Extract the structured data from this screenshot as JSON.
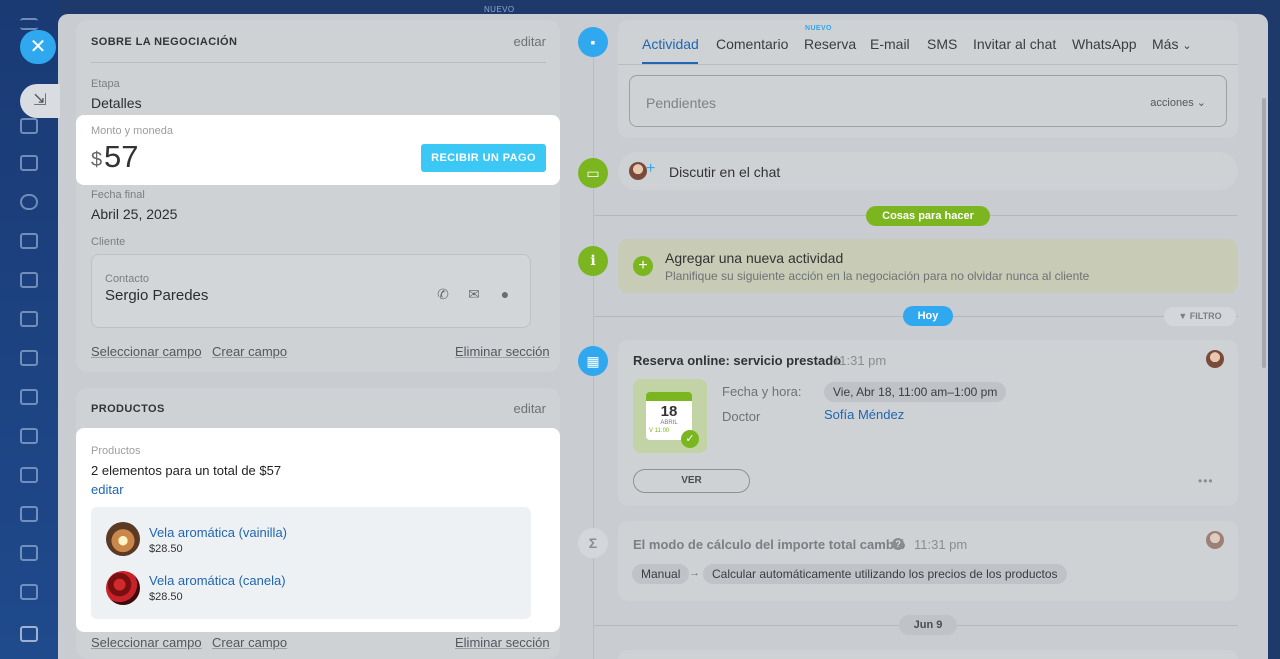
{
  "panel_top_nuevo": "NUEVO",
  "deal": {
    "title": "SOBRE LA NEGOCIACIÓN",
    "edit": "editar",
    "stage_label": "Etapa",
    "stage_value": "Detalles",
    "amount_label": "Monto y moneda",
    "amount_currency": "$",
    "amount_value": "57",
    "pay_button": "RECIBIR UN PAGO",
    "end_label": "Fecha final",
    "end_value": "Abril 25, 2025",
    "client_label": "Cliente",
    "contact_label": "Contacto",
    "contact_name": "Sergio Paredes",
    "select_field": "Seleccionar campo",
    "create_field": "Crear campo",
    "delete_section": "Eliminar sección"
  },
  "products": {
    "title": "PRODUCTOS",
    "edit": "editar",
    "label": "Productos",
    "summary": "2 elementos para un total de $57",
    "edit_link": "editar",
    "items": [
      {
        "name": "Vela aromática (vainilla)",
        "price": "$28.50"
      },
      {
        "name": "Vela aromática (canela)",
        "price": "$28.50"
      }
    ],
    "select_field": "Seleccionar campo",
    "create_field": "Crear campo",
    "delete_section": "Eliminar sección"
  },
  "tabs": {
    "items": [
      "Actividad",
      "Comentario",
      "Reserva",
      "E-mail",
      "SMS",
      "Invitar al chat",
      "WhatsApp",
      "Más"
    ],
    "reserva_badge": "NUEVO",
    "pending_placeholder": "Pendientes",
    "actions": "acciones"
  },
  "chat": {
    "label": "Discutir en el chat"
  },
  "todo_pill": "Cosas para hacer",
  "add_activity": {
    "title": "Agregar una nueva actividad",
    "subtitle": "Planifique su siguiente acción en la negociación para no olvidar nunca al cliente"
  },
  "today_pill": "Hoy",
  "filter": "FILTRO",
  "booking": {
    "title": "Reserva online: servicio prestado",
    "time": "11:31 pm",
    "cal_day": "18",
    "cal_month": "ABRIL",
    "cal_time": "V 11:00",
    "date_label": "Fecha y hora:",
    "date_value": "Vie, Abr 18, 11:00 am–1:00 pm",
    "doctor_label": "Doctor",
    "doctor_value": "Sofía Méndez",
    "view_button": "VER",
    "more": "•••"
  },
  "calc": {
    "title": "El modo de cálculo del importe total cambió",
    "time": "11:31 pm",
    "from": "Manual",
    "arrow": "→",
    "to": "Calcular automáticamente utilizando los precios de los productos"
  },
  "jun_pill": "Jun 9",
  "colors": {
    "accent": "#2fa8f0",
    "pay_button": "#3bc8f5",
    "link": "#2066b0",
    "todo_green": "#7bb520",
    "timeline_blue": "#2fa8f0"
  }
}
